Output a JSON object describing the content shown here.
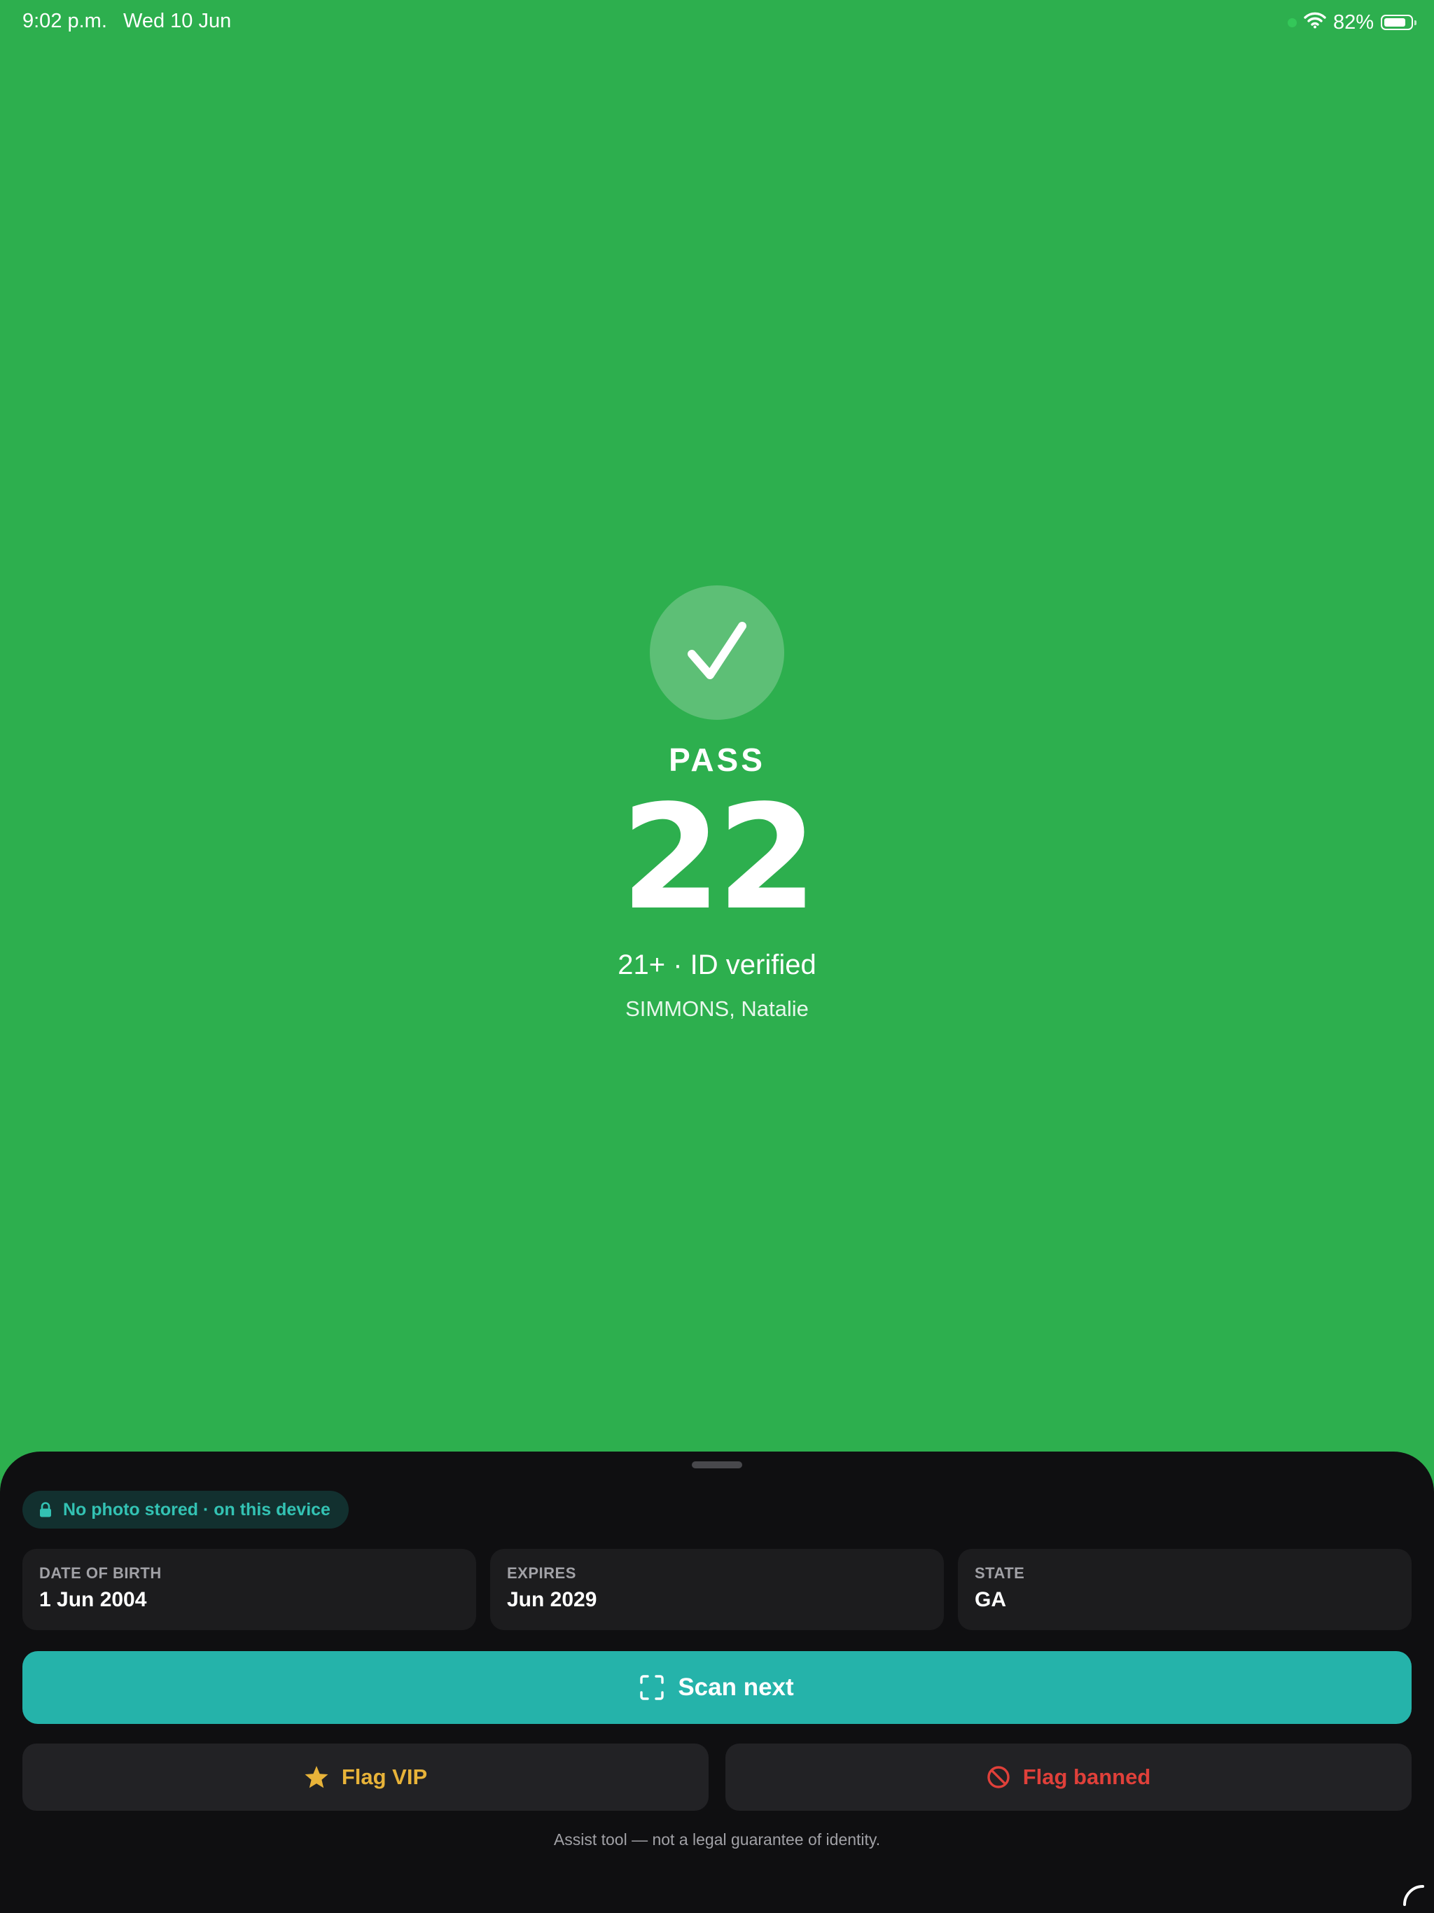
{
  "status_bar": {
    "time": "9:02 p.m.",
    "date": "Wed 10 Jun",
    "battery": "82%",
    "battery_level": 0.82
  },
  "result": {
    "verdict": "PASS",
    "age": "22",
    "summary": "21+ · ID verified",
    "name": "SIMMONS, Natalie",
    "icon": "checkmark-icon"
  },
  "sheet": {
    "privacy": {
      "text": "No photo stored · on this device",
      "icon": "lock-icon"
    },
    "fields": [
      {
        "label": "DATE OF BIRTH",
        "value": "1 Jun 2004"
      },
      {
        "label": "EXPIRES",
        "value": "Jun 2029"
      },
      {
        "label": "STATE",
        "value": "GA"
      }
    ],
    "scan_button": {
      "label": "Scan next",
      "icon": "scan-frame-icon"
    },
    "flag_vip": {
      "label": "Flag VIP",
      "icon": "star-icon"
    },
    "flag_banned": {
      "label": "Flag banned",
      "icon": "prohibited-icon"
    },
    "disclaimer": "Assist tool — not a legal guarantee of identity."
  },
  "colors": {
    "pass_background": "#2daf4e",
    "sheet_background": "#0f0f11",
    "accent_teal": "#25b3aa",
    "vip": "#e8b339",
    "banned": "#e0403a"
  }
}
